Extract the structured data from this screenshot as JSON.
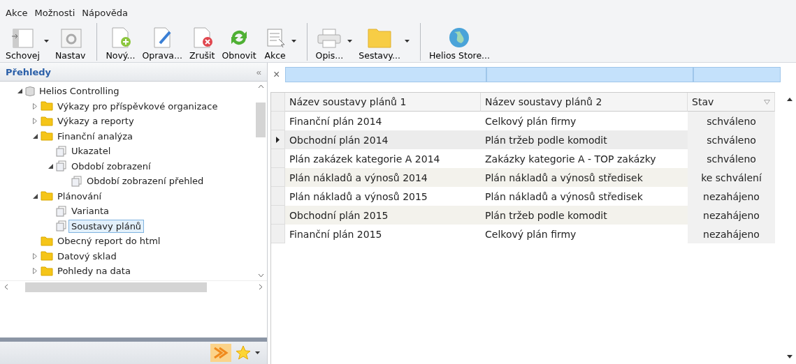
{
  "menu": [
    "Akce",
    "Možnosti",
    "Nápověda"
  ],
  "toolbar": [
    [
      {
        "label": "Schovej",
        "dropdown": true
      },
      {
        "label": "Nastav",
        "dropdown": false
      }
    ],
    [
      {
        "label": "Nový...",
        "dropdown": false
      },
      {
        "label": "Oprava...",
        "dropdown": false
      },
      {
        "label": "Zrušit",
        "dropdown": false
      },
      {
        "label": "Obnovit",
        "dropdown": false
      },
      {
        "label": "Akce",
        "dropdown": true
      }
    ],
    [
      {
        "label": "Opis...",
        "dropdown": true
      },
      {
        "label": "Sestavy...",
        "dropdown": true
      }
    ],
    [
      {
        "label": "Helios Store...",
        "dropdown": false
      }
    ]
  ],
  "sidebar": {
    "title": "Přehledy",
    "collapse": "«",
    "tree": [
      {
        "label": "Helios Controlling",
        "kind": "database",
        "expanded": true,
        "selected": false,
        "children": [
          {
            "label": "Výkazy pro příspěvkové organizace",
            "kind": "folder",
            "expanded": false,
            "selected": false
          },
          {
            "label": "Výkazy a reporty",
            "kind": "folder",
            "expanded": false,
            "selected": false
          },
          {
            "label": "Finanční analýza",
            "kind": "folder",
            "expanded": true,
            "selected": false,
            "children": [
              {
                "label": "Ukazatel",
                "kind": "page",
                "selected": false
              },
              {
                "label": "Období zobrazení",
                "kind": "page",
                "expanded": true,
                "selected": false,
                "children": [
                  {
                    "label": "Období zobrazení přehled",
                    "kind": "page",
                    "selected": false
                  }
                ]
              }
            ]
          },
          {
            "label": "Plánování",
            "kind": "folder",
            "expanded": true,
            "selected": false,
            "children": [
              {
                "label": "Varianta",
                "kind": "page",
                "selected": false
              },
              {
                "label": "Soustavy plánů",
                "kind": "page",
                "selected": true
              }
            ]
          },
          {
            "label": "Obecný report do html",
            "kind": "folder",
            "selected": false
          },
          {
            "label": "Datový sklad",
            "kind": "folder",
            "expanded": false,
            "selected": false
          },
          {
            "label": "Pohledy na data",
            "kind": "folder",
            "expanded": false,
            "selected": false
          }
        ]
      }
    ]
  },
  "filter_row": {
    "close": "×"
  },
  "table": {
    "columns": [
      "Název soustavy plánů 1",
      "Název soustavy plánů 2",
      "Stav"
    ],
    "rows": [
      {
        "cells": [
          "Finanční plán 2014",
          "Celkový plán firmy",
          "schváleno"
        ],
        "selected": false
      },
      {
        "cells": [
          "Obchodní plán 2014",
          "Plán tržeb podle komodit",
          "schváleno"
        ],
        "selected": true
      },
      {
        "cells": [
          "Plán zakázek kategorie A 2014",
          "Zakázky kategorie A - TOP zakázky",
          "schváleno"
        ],
        "selected": false
      },
      {
        "cells": [
          "Plán nákladů a výnosů 2014",
          "Plán nákladů a výnosů středisek",
          "ke schválení"
        ],
        "selected": false
      },
      {
        "cells": [
          "Plán nákladů a výnosů 2015",
          "Plán nákladů a výnosů středisek",
          "nezahájeno"
        ],
        "selected": false
      },
      {
        "cells": [
          "Obchodní plán 2015",
          "Plán tržeb podle komodit",
          "nezahájeno"
        ],
        "selected": false
      },
      {
        "cells": [
          "Finanční plán 2015",
          "Celkový plán firmy",
          "nezahájeno"
        ],
        "selected": false
      }
    ]
  }
}
